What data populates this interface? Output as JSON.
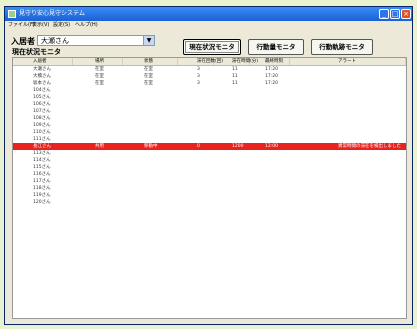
{
  "window": {
    "title": "見守り安心見守システム"
  },
  "menu": [
    "ファイル(F)",
    "表示(V)",
    "設定(S)",
    "ヘルプ(H)"
  ],
  "resident": {
    "label": "入居者",
    "selected": "大瀬さん"
  },
  "buttons": [
    "現在状況モニタ",
    "行動量モニタ",
    "行動軌跡モニタ"
  ],
  "section_title": "現在状況モニタ",
  "table": {
    "headers": [
      "入居者",
      "場所",
      "状態",
      "滞在回数(回)",
      "滞在時間(分)",
      "最終時刻",
      "アラート"
    ],
    "rows": [
      [
        "大瀬さん",
        "在室",
        "在室",
        "3",
        "11",
        "17:20",
        ""
      ],
      [
        "大橋さん",
        "在室",
        "在室",
        "3",
        "11",
        "17:20",
        ""
      ],
      [
        "坂本さん",
        "在室",
        "在室",
        "3",
        "11",
        "17:20",
        ""
      ],
      [
        "104さん",
        "",
        "",
        "",
        "",
        "",
        ""
      ],
      [
        "105さん",
        "",
        "",
        "",
        "",
        "",
        ""
      ],
      [
        "106さん",
        "",
        "",
        "",
        "",
        "",
        ""
      ],
      [
        "107さん",
        "",
        "",
        "",
        "",
        "",
        ""
      ],
      [
        "108さん",
        "",
        "",
        "",
        "",
        "",
        ""
      ],
      [
        "109さん",
        "",
        "",
        "",
        "",
        "",
        ""
      ],
      [
        "110さん",
        "",
        "",
        "",
        "",
        "",
        ""
      ],
      [
        "111さん",
        "",
        "",
        "",
        "",
        "",
        ""
      ],
      [
        "長江さん",
        "共用",
        "移動中",
        "0",
        "1200",
        "12:00",
        "異常時間の滞在を検出しました"
      ],
      [
        "113さん",
        "",
        "",
        "",
        "",
        "",
        ""
      ],
      [
        "114さん",
        "",
        "",
        "",
        "",
        "",
        ""
      ],
      [
        "115さん",
        "",
        "",
        "",
        "",
        "",
        ""
      ],
      [
        "116さん",
        "",
        "",
        "",
        "",
        "",
        ""
      ],
      [
        "117さん",
        "",
        "",
        "",
        "",
        "",
        ""
      ],
      [
        "118さん",
        "",
        "",
        "",
        "",
        "",
        ""
      ],
      [
        "119さん",
        "",
        "",
        "",
        "",
        "",
        ""
      ],
      [
        "120さん",
        "",
        "",
        "",
        "",
        "",
        ""
      ]
    ],
    "alert_row_index": 11,
    "alert_color": "#e8231f"
  }
}
